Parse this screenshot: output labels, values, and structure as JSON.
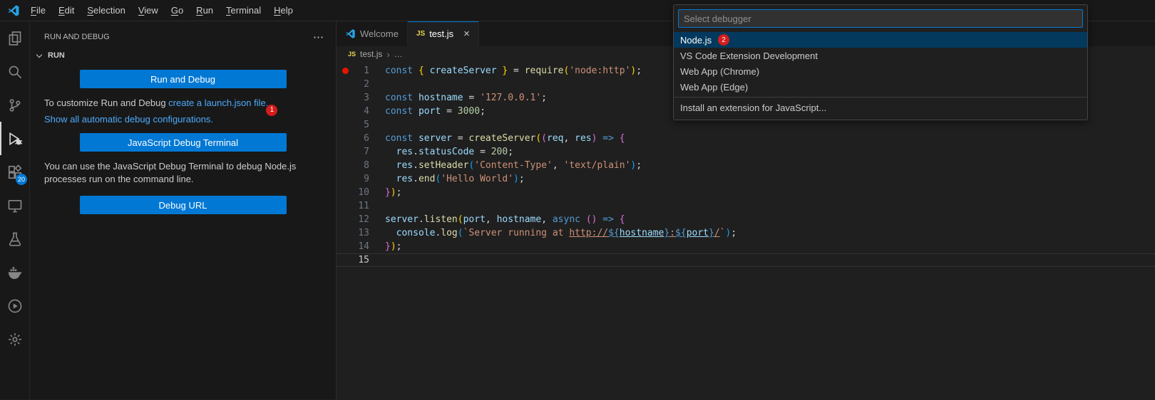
{
  "colors": {
    "accent": "#0078d4",
    "selection": "#04395e",
    "link": "#4daafc",
    "badge_red": "#d41c1c",
    "badge_blue": "#0078d4",
    "breakpoint": "#e51400",
    "tok_kw": "#569cd6",
    "tok_vr": "#9cdcfe",
    "tok_fn": "#dcdcaa",
    "tok_st": "#ce9178",
    "tok_nm": "#b5cea8",
    "tok_pn": "#d4d4d4",
    "tok_b1": "#ffd700",
    "tok_b2": "#da70d6",
    "tok_b3": "#179fff"
  },
  "icons": {
    "more_actions": "⋯",
    "close": "×",
    "js_glyph": "JS",
    "breadcrumb_separator": "›",
    "breadcrumb_more": "…"
  },
  "menu_bar": {
    "items": [
      "File",
      "Edit",
      "Selection",
      "View",
      "Go",
      "Run",
      "Terminal",
      "Help"
    ]
  },
  "activity_bar": {
    "items": [
      {
        "icon": "explorer-icon"
      },
      {
        "icon": "search-icon"
      },
      {
        "icon": "source-control-icon"
      },
      {
        "icon": "run-debug-icon",
        "active": true
      },
      {
        "icon": "extensions-icon",
        "badge": "20"
      },
      {
        "icon": "remote-explorer-icon"
      },
      {
        "icon": "testing-icon"
      },
      {
        "icon": "docker-icon"
      },
      {
        "icon": "play-circle-icon"
      },
      {
        "icon": "settings-gear-icon"
      }
    ]
  },
  "sidebar": {
    "title": "RUN AND DEBUG",
    "section": "RUN",
    "run_button": "Run and Debug",
    "customize_text": "To customize Run and Debug ",
    "customize_link": "create a launch.json file.",
    "customize_badge": "1",
    "show_configs_link": "Show all automatic debug configurations.",
    "js_terminal_button": "JavaScript Debug Terminal",
    "terminal_text": "You can use the JavaScript Debug Terminal to debug Node.js processes run on the command line.",
    "debug_url_button": "Debug URL"
  },
  "quick_pick": {
    "placeholder": "Select debugger",
    "items": [
      {
        "label": "Node.js",
        "badge": "2",
        "selected": true
      },
      {
        "label": "VS Code Extension Development"
      },
      {
        "label": "Web App (Chrome)"
      },
      {
        "label": "Web App (Edge)"
      },
      {
        "label": "Install an extension for JavaScript...",
        "separator_above": true
      }
    ]
  },
  "editor": {
    "tabs": [
      {
        "label": "Welcome",
        "icon": "vscode-icon",
        "active": false
      },
      {
        "label": "test.js",
        "icon": "js-icon",
        "active": true
      }
    ],
    "breadcrumb": {
      "file": "test.js"
    },
    "breakpoint_line": 1,
    "active_line": 15,
    "lines": [
      {
        "n": 1,
        "tokens": [
          [
            "kw",
            "const"
          ],
          [
            "pn",
            " "
          ],
          [
            "b1",
            "{"
          ],
          [
            "vr",
            " createServer "
          ],
          [
            "b1",
            "}"
          ],
          [
            "pn",
            " = "
          ],
          [
            "fn",
            "require"
          ],
          [
            "b1",
            "("
          ],
          [
            "st",
            "'node:http'"
          ],
          [
            "b1",
            ")"
          ],
          [
            "pn",
            ";"
          ]
        ]
      },
      {
        "n": 2,
        "tokens": []
      },
      {
        "n": 3,
        "tokens": [
          [
            "kw",
            "const"
          ],
          [
            "pn",
            " "
          ],
          [
            "vr",
            "hostname"
          ],
          [
            "pn",
            " = "
          ],
          [
            "st",
            "'127.0.0.1'"
          ],
          [
            "pn",
            ";"
          ]
        ]
      },
      {
        "n": 4,
        "tokens": [
          [
            "kw",
            "const"
          ],
          [
            "pn",
            " "
          ],
          [
            "vr",
            "port"
          ],
          [
            "pn",
            " = "
          ],
          [
            "nm",
            "3000"
          ],
          [
            "pn",
            ";"
          ]
        ]
      },
      {
        "n": 5,
        "tokens": []
      },
      {
        "n": 6,
        "tokens": [
          [
            "kw",
            "const"
          ],
          [
            "pn",
            " "
          ],
          [
            "vr",
            "server"
          ],
          [
            "pn",
            " = "
          ],
          [
            "fn",
            "createServer"
          ],
          [
            "b1",
            "("
          ],
          [
            "b2",
            "("
          ],
          [
            "vr",
            "req"
          ],
          [
            "pn",
            ", "
          ],
          [
            "vr",
            "res"
          ],
          [
            "b2",
            ")"
          ],
          [
            "pn",
            " "
          ],
          [
            "kw",
            "=>"
          ],
          [
            "pn",
            " "
          ],
          [
            "b2",
            "{"
          ]
        ]
      },
      {
        "n": 7,
        "tokens": [
          [
            "pn",
            "  "
          ],
          [
            "vr",
            "res"
          ],
          [
            "pn",
            "."
          ],
          [
            "vr",
            "statusCode"
          ],
          [
            "pn",
            " = "
          ],
          [
            "nm",
            "200"
          ],
          [
            "pn",
            ";"
          ]
        ]
      },
      {
        "n": 8,
        "tokens": [
          [
            "pn",
            "  "
          ],
          [
            "vr",
            "res"
          ],
          [
            "pn",
            "."
          ],
          [
            "fn",
            "setHeader"
          ],
          [
            "b3",
            "("
          ],
          [
            "st",
            "'Content-Type'"
          ],
          [
            "pn",
            ", "
          ],
          [
            "st",
            "'text/plain'"
          ],
          [
            "b3",
            ")"
          ],
          [
            "pn",
            ";"
          ]
        ]
      },
      {
        "n": 9,
        "tokens": [
          [
            "pn",
            "  "
          ],
          [
            "vr",
            "res"
          ],
          [
            "pn",
            "."
          ],
          [
            "fn",
            "end"
          ],
          [
            "b3",
            "("
          ],
          [
            "st",
            "'Hello World'"
          ],
          [
            "b3",
            ")"
          ],
          [
            "pn",
            ";"
          ]
        ]
      },
      {
        "n": 10,
        "tokens": [
          [
            "b2",
            "}"
          ],
          [
            "b1",
            ")"
          ],
          [
            "pn",
            ";"
          ]
        ]
      },
      {
        "n": 11,
        "tokens": []
      },
      {
        "n": 12,
        "tokens": [
          [
            "vr",
            "server"
          ],
          [
            "pn",
            "."
          ],
          [
            "fn",
            "listen"
          ],
          [
            "b1",
            "("
          ],
          [
            "vr",
            "port"
          ],
          [
            "pn",
            ", "
          ],
          [
            "vr",
            "hostname"
          ],
          [
            "pn",
            ", "
          ],
          [
            "kw",
            "async"
          ],
          [
            "pn",
            " "
          ],
          [
            "b2",
            "("
          ],
          [
            "b2",
            ")"
          ],
          [
            "pn",
            " "
          ],
          [
            "kw",
            "=>"
          ],
          [
            "pn",
            " "
          ],
          [
            "b2",
            "{"
          ]
        ]
      },
      {
        "n": 13,
        "tokens": [
          [
            "pn",
            "  "
          ],
          [
            "vr",
            "console"
          ],
          [
            "pn",
            "."
          ],
          [
            "fn",
            "log"
          ],
          [
            "b3",
            "("
          ],
          [
            "st",
            "`Server running at "
          ],
          [
            "st",
            "http://",
            "u"
          ],
          [
            "kw",
            "${",
            "u"
          ],
          [
            "vr",
            "hostname",
            "u"
          ],
          [
            "kw",
            "}",
            "u"
          ],
          [
            "st",
            ":",
            "u"
          ],
          [
            "kw",
            "${",
            "u"
          ],
          [
            "vr",
            "port",
            "u"
          ],
          [
            "kw",
            "}",
            "u"
          ],
          [
            "st",
            "/",
            "u"
          ],
          [
            "st",
            "`"
          ],
          [
            "b3",
            ")"
          ],
          [
            "pn",
            ";"
          ]
        ]
      },
      {
        "n": 14,
        "tokens": [
          [
            "b2",
            "}"
          ],
          [
            "b1",
            ")"
          ],
          [
            "pn",
            ";"
          ]
        ]
      },
      {
        "n": 15,
        "tokens": []
      }
    ]
  }
}
